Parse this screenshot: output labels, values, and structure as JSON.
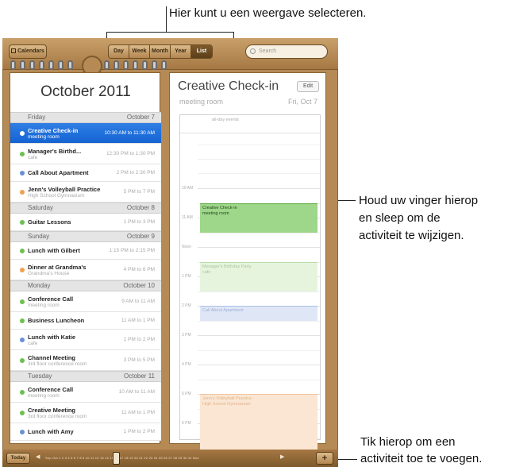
{
  "callouts": {
    "top": "Hier kunt u een weergave selecteren.",
    "right_middle_1": "Houd uw vinger hierop",
    "right_middle_2": "en sleep om de",
    "right_middle_3": "activiteit te wijzigen.",
    "right_bottom_1": "Tik hierop om een",
    "right_bottom_2": "activiteit toe te voegen."
  },
  "toolbar": {
    "calendars_label": "Calendars",
    "views": [
      "Day",
      "Week",
      "Month",
      "Year",
      "List"
    ],
    "active_view": "List",
    "search_placeholder": "Search"
  },
  "month_title": "October 2011",
  "days": [
    {
      "name": "Friday",
      "date": "October 7"
    },
    {
      "name": "Saturday",
      "date": "October 8"
    },
    {
      "name": "Sunday",
      "date": "October 9"
    },
    {
      "name": "Monday",
      "date": "October 10"
    },
    {
      "name": "Tuesday",
      "date": "October 11"
    }
  ],
  "events": [
    {
      "title": "Creative Check-in",
      "sub": "meeting room",
      "time": "10:30 AM to 11:30 AM",
      "color": "#6cc14f"
    },
    {
      "title": "Manager's Birthd...",
      "sub": "cafe",
      "time": "12:30 PM to 1:30 PM",
      "color": "#6cc14f"
    },
    {
      "title": "Call About Apartment",
      "sub": "",
      "time": "2 PM to 2:30 PM",
      "color": "#6b8fd6"
    },
    {
      "title": "Jenn's Volleyball Practice",
      "sub": "High School Gymnasium",
      "time": "5 PM to 7 PM",
      "color": "#f0a050"
    },
    {
      "title": "Guitar Lessons",
      "sub": "",
      "time": "1 PM to 3 PM",
      "color": "#6cc14f"
    },
    {
      "title": "Lunch with Gilbert",
      "sub": "",
      "time": "1:15 PM to 2:15 PM",
      "color": "#6cc14f"
    },
    {
      "title": "Dinner at Grandma's",
      "sub": "Grandma's House",
      "time": "4 PM to 6 PM",
      "color": "#f0a050"
    },
    {
      "title": "Conference Call",
      "sub": "meeting room",
      "time": "9 AM to 11 AM",
      "color": "#6cc14f"
    },
    {
      "title": "Business Luncheon",
      "sub": "",
      "time": "11 AM to 1 PM",
      "color": "#6cc14f"
    },
    {
      "title": "Lunch with Katie",
      "sub": "cafe",
      "time": "1 PM to 2 PM",
      "color": "#6b8fd6"
    },
    {
      "title": "Channel Meeting",
      "sub": "3rd floor conference room",
      "time": "3 PM to 5 PM",
      "color": "#6cc14f"
    },
    {
      "title": "Conference Call",
      "sub": "meeting room",
      "time": "10 AM to 11 AM",
      "color": "#6cc14f"
    },
    {
      "title": "Creative Meeting",
      "sub": "3rd floor conference room",
      "time": "11 AM to 1 PM",
      "color": "#6cc14f"
    },
    {
      "title": "Lunch with Amy",
      "sub": "",
      "time": "1 PM to 2 PM",
      "color": "#6b8fd6"
    }
  ],
  "detail": {
    "title": "Creative Check-in",
    "edit_label": "Edit",
    "location": "meeting room",
    "date": "Fri, Oct 7",
    "all_day": "all-day events",
    "hours": [
      "10 AM",
      "11 AM",
      "Noon",
      "1 PM",
      "2 PM",
      "3 PM",
      "4 PM",
      "5 PM",
      "6 PM",
      "7 PM"
    ],
    "blocks": [
      {
        "line1": "Creative Check-in",
        "line2": "meeting room",
        "bg": "#9ed68a",
        "border": "#5aa83f",
        "fg": "#22461a"
      },
      {
        "line1": "Manager's Birthday Party",
        "line2": "cafe",
        "bg": "#e6f4de",
        "border": "#b8dda6",
        "fg": "#a8c99a"
      },
      {
        "line1": "Call About Apartment",
        "line2": "",
        "bg": "#dfe7f7",
        "border": "#aabfe6",
        "fg": "#9fb0d6"
      },
      {
        "line1": "Jenn's Volleyball Practice",
        "line2": "High School Gymnasium",
        "bg": "#fbe6d3",
        "border": "#efc39d",
        "fg": "#e0b48c"
      }
    ]
  },
  "bottom": {
    "today_label": "Today",
    "timeline_text": "Sep   Oct 1 2 3 4 5 6 7 8 9 10 11 12 13 14 15 16 17 18 19 20 21 22 23 24 25 26 27 28 29 30 31   Nov",
    "add_label": "+"
  }
}
